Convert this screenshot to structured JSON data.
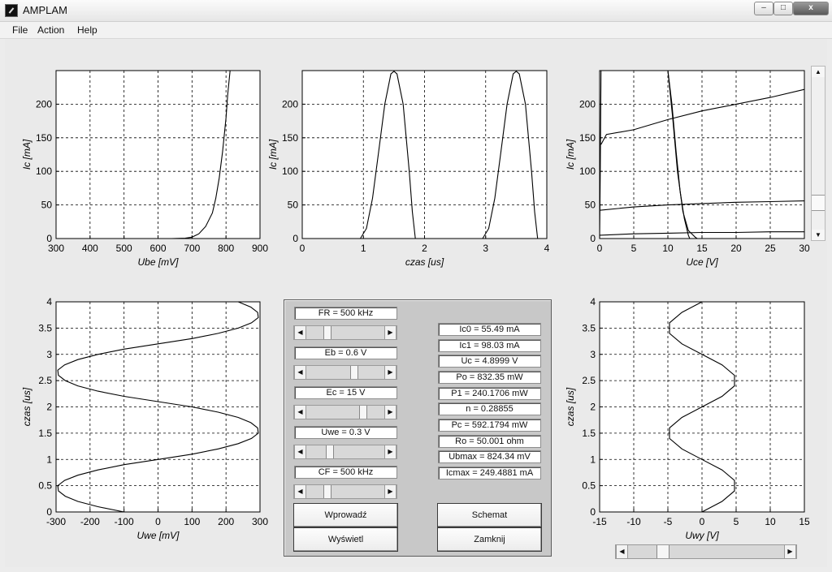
{
  "window": {
    "title": "AMPLAM",
    "min_label": "–",
    "max_label": "□",
    "close_label": "x"
  },
  "menu": [
    "File",
    "Action",
    "Help"
  ],
  "controls": {
    "sliders": [
      {
        "label": "FR = 500  kHz",
        "value": 0.25
      },
      {
        "label": "Eb = 0.6  V",
        "value": 0.62
      },
      {
        "label": "Ec = 15  V",
        "value": 0.75
      },
      {
        "label": "Uwe = 0.3  V",
        "value": 0.28
      },
      {
        "label": "CF = 500  kHz",
        "value": 0.25
      }
    ],
    "results": [
      "Ic0 = 55.49 mA",
      "Ic1 = 98.03 mA",
      "Uc = 4.8999 V",
      "Po = 832.35 mW",
      "P1 = 240.1706 mW",
      "n = 0.28855",
      "Pc = 592.1794 mW",
      "Ro = 50.001 ohm",
      "Ubmax = 824.34 mV",
      "Icmax = 249.4881 mA"
    ],
    "buttons": {
      "wprowadz": "Wprowadź",
      "schemat": "Schemat",
      "wyswietl": "Wyświetl",
      "zamknij": "Zamknij"
    }
  },
  "bottom_slider_value": 0.2,
  "chart_data": [
    {
      "type": "line",
      "xlabel": "Ube [mV]",
      "ylabel": "Ic [mA]",
      "xlim": [
        300,
        900
      ],
      "ylim": [
        0,
        250
      ],
      "xticks": [
        300,
        400,
        500,
        600,
        700,
        800,
        900
      ],
      "yticks": [
        0,
        50,
        100,
        150,
        200
      ],
      "series": [
        {
          "points": [
            [
              640,
              0
            ],
            [
              680,
              0.5
            ],
            [
              700,
              2
            ],
            [
              720,
              7
            ],
            [
              740,
              18
            ],
            [
              760,
              38
            ],
            [
              770,
              60
            ],
            [
              780,
              90
            ],
            [
              790,
              130
            ],
            [
              800,
              180
            ],
            [
              805,
              215
            ],
            [
              812,
              250
            ]
          ]
        }
      ]
    },
    {
      "type": "line",
      "xlabel": "czas [us]",
      "ylabel": "Ic [mA]",
      "xlim": [
        0,
        4
      ],
      "ylim": [
        0,
        250
      ],
      "xticks": [
        0,
        1,
        2,
        3,
        4
      ],
      "yticks": [
        0,
        50,
        100,
        150,
        200
      ],
      "series": [
        {
          "points": [
            [
              0,
              0
            ],
            [
              0.95,
              0
            ],
            [
              1.05,
              15
            ],
            [
              1.15,
              60
            ],
            [
              1.25,
              130
            ],
            [
              1.35,
              200
            ],
            [
              1.45,
              245
            ],
            [
              1.5,
              249
            ],
            [
              1.55,
              245
            ],
            [
              1.65,
              200
            ],
            [
              1.75,
              100
            ],
            [
              1.8,
              40
            ],
            [
              1.85,
              0
            ],
            [
              2.95,
              0
            ],
            [
              3.05,
              15
            ],
            [
              3.15,
              60
            ],
            [
              3.25,
              130
            ],
            [
              3.35,
              200
            ],
            [
              3.45,
              245
            ],
            [
              3.5,
              249
            ],
            [
              3.55,
              245
            ],
            [
              3.65,
              200
            ],
            [
              3.75,
              100
            ],
            [
              3.8,
              40
            ],
            [
              3.85,
              0
            ],
            [
              4,
              0
            ]
          ]
        }
      ]
    },
    {
      "type": "line",
      "xlabel": "Uce [V]",
      "ylabel": "Ic [mA]",
      "xlim": [
        0,
        30
      ],
      "ylim": [
        0,
        250
      ],
      "xticks": [
        0,
        5,
        10,
        15,
        20,
        25,
        30
      ],
      "yticks": [
        0,
        50,
        100,
        150,
        200
      ],
      "series": [
        {
          "points": [
            [
              0,
              0
            ],
            [
              0.1,
              100
            ],
            [
              0.2,
              250
            ]
          ]
        },
        {
          "points": [
            [
              0.2,
              140
            ],
            [
              1,
              155
            ],
            [
              5,
              162
            ],
            [
              10,
              177
            ],
            [
              15,
              190
            ],
            [
              20,
              200
            ],
            [
              25,
              210
            ],
            [
              30,
              222
            ]
          ]
        },
        {
          "points": [
            [
              0,
              42
            ],
            [
              5,
              47
            ],
            [
              10,
              50
            ],
            [
              15,
              52
            ],
            [
              20,
              54
            ],
            [
              25,
              55
            ],
            [
              30,
              56
            ]
          ]
        },
        {
          "points": [
            [
              0,
              5
            ],
            [
              5,
              7
            ],
            [
              10,
              8
            ],
            [
              15,
              9
            ],
            [
              20,
              9
            ],
            [
              25,
              10
            ],
            [
              30,
              10
            ]
          ]
        },
        {
          "points": [
            [
              10,
              250
            ],
            [
              10.6,
              200
            ],
            [
              11.2,
              130
            ],
            [
              11.8,
              70
            ],
            [
              12.4,
              30
            ],
            [
              13,
              5
            ],
            [
              13.2,
              0
            ]
          ]
        },
        {
          "points": [
            [
              10,
              250
            ],
            [
              10.7,
              180
            ],
            [
              11.4,
              100
            ],
            [
              12.2,
              40
            ],
            [
              13,
              12
            ],
            [
              14,
              2
            ],
            [
              14.3,
              0
            ]
          ]
        }
      ]
    },
    {
      "type": "line",
      "xlabel": "Uwe [mV]",
      "ylabel": "czas [us]",
      "xlim": [
        -300,
        300
      ],
      "ylim": [
        0,
        4
      ],
      "xticks": [
        -300,
        -200,
        -100,
        0,
        100,
        200,
        300
      ],
      "yticks": [
        0,
        0.5,
        1,
        1.5,
        2,
        2.5,
        3,
        3.5,
        4
      ],
      "series": [
        {
          "points": [
            [
              -100,
              0
            ],
            [
              -177,
              0.1
            ],
            [
              -236,
              0.2
            ],
            [
              -273,
              0.3
            ],
            [
              -293,
              0.4
            ],
            [
              -295,
              0.5
            ],
            [
              -275,
              0.6
            ],
            [
              -236,
              0.7
            ],
            [
              -177,
              0.8
            ],
            [
              -100,
              0.9
            ],
            [
              0,
              1.0
            ],
            [
              100,
              1.1
            ],
            [
              177,
              1.2
            ],
            [
              236,
              1.3
            ],
            [
              275,
              1.4
            ],
            [
              295,
              1.5
            ],
            [
              293,
              1.6
            ],
            [
              273,
              1.7
            ],
            [
              236,
              1.8
            ],
            [
              177,
              1.9
            ],
            [
              100,
              2.0
            ],
            [
              0,
              2.1
            ],
            [
              -100,
              2.2
            ],
            [
              -177,
              2.3
            ],
            [
              -236,
              2.4
            ],
            [
              -273,
              2.5
            ],
            [
              -293,
              2.6
            ],
            [
              -295,
              2.7
            ],
            [
              -275,
              2.8
            ],
            [
              -236,
              2.9
            ],
            [
              -177,
              3.0
            ],
            [
              -100,
              3.1
            ],
            [
              0,
              3.2
            ],
            [
              100,
              3.3
            ],
            [
              177,
              3.4
            ],
            [
              236,
              3.5
            ],
            [
              275,
              3.6
            ],
            [
              295,
              3.7
            ],
            [
              293,
              3.8
            ],
            [
              273,
              3.9
            ],
            [
              236,
              4.0
            ]
          ]
        }
      ]
    },
    {
      "type": "line",
      "xlabel": "Uwy [V]",
      "ylabel": "czas [us]",
      "xlim": [
        -15,
        15
      ],
      "ylim": [
        0,
        4
      ],
      "xticks": [
        -15,
        -10,
        -5,
        0,
        5,
        10,
        15
      ],
      "yticks": [
        0,
        0.5,
        1,
        1.5,
        2,
        2.5,
        3,
        3.5,
        4
      ],
      "series": [
        {
          "points": [
            [
              0,
              0
            ],
            [
              2.94,
              0.2
            ],
            [
              4.76,
              0.4
            ],
            [
              4.76,
              0.6
            ],
            [
              2.94,
              0.8
            ],
            [
              0,
              1.0
            ],
            [
              -2.94,
              1.2
            ],
            [
              -4.76,
              1.4
            ],
            [
              -4.76,
              1.6
            ],
            [
              -2.94,
              1.8
            ],
            [
              0,
              2.0
            ],
            [
              2.94,
              2.2
            ],
            [
              4.76,
              2.4
            ],
            [
              4.76,
              2.6
            ],
            [
              2.94,
              2.8
            ],
            [
              0,
              3.0
            ],
            [
              -2.94,
              3.2
            ],
            [
              -4.76,
              3.4
            ],
            [
              -4.76,
              3.6
            ],
            [
              -2.94,
              3.8
            ],
            [
              0,
              4.0
            ]
          ]
        }
      ]
    }
  ]
}
